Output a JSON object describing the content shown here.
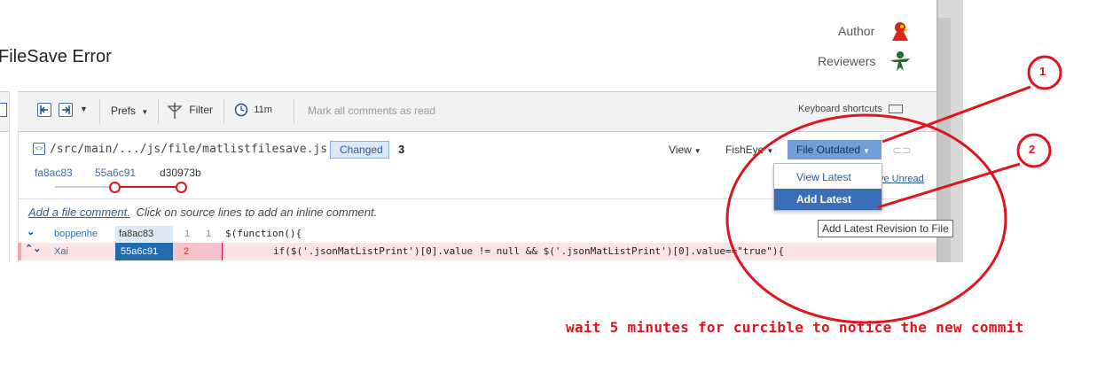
{
  "review": {
    "title_fragment": "FileSave Error",
    "author_label": "Author",
    "reviewers_label": "Reviewers"
  },
  "toolbar": {
    "prefs_label": "Prefs",
    "filter_label": "Filter",
    "time_label": "11m",
    "mark_read_label": "Mark all comments as read",
    "keyboard_label": "Keyboard shortcuts"
  },
  "file": {
    "path": "/src/main/.../js/file/matlistfilesave.js",
    "status_badge": "Changed",
    "count": "3",
    "view_label": "View",
    "fisheye_label": "FishEye",
    "outdated_label": "File Outdated",
    "leave_unread_fragment": "ve Unread",
    "revisions": [
      "fa8ac83",
      "55a6c91",
      "d30973b"
    ]
  },
  "dropdown": {
    "items": [
      "View Latest",
      "Add Latest"
    ],
    "selected": "Add Latest"
  },
  "tooltip": "Add Latest Revision to File",
  "comment_bar": {
    "link": "Add a file comment.",
    "hint": "Click on source lines to add an inline comment."
  },
  "code_lines": [
    {
      "author": "boppenhe",
      "revision": "fa8ac83",
      "old_line": "1",
      "new_line": "1",
      "code": "$(function(){"
    },
    {
      "author": "Xai",
      "revision": "55a6c91",
      "old_line": "2",
      "new_line": "",
      "code": "if($('.jsonMatListPrint')[0].value != null && $('.jsonMatListPrint')[0].value==\"true\"){"
    }
  ],
  "annotations": {
    "marker_1": "1",
    "marker_2": "2",
    "note": "wait 5 minutes for curcible to notice the new commit"
  },
  "colors": {
    "annotation_red": "#e0141e",
    "outdated_bg": "#6f9fd6",
    "selected_bg": "#3a6fb8",
    "removed_line_bg": "#fbe3e6",
    "removed_revision_bg": "#1f6cb0"
  }
}
